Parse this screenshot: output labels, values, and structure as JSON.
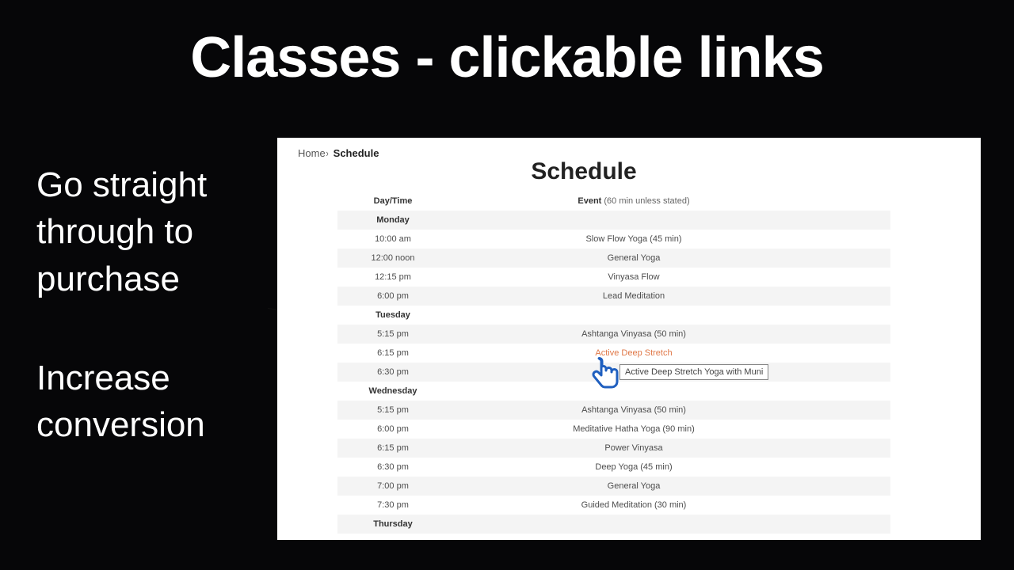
{
  "slide": {
    "title": "Classes - clickable links",
    "callout1_line1": "Go straight",
    "callout1_line2": "through to",
    "callout1_line3": "purchase",
    "callout2_line1": "Increase",
    "callout2_line2": "conversion"
  },
  "breadcrumb": {
    "home": "Home",
    "current": "Schedule"
  },
  "page": {
    "heading": "Schedule"
  },
  "table": {
    "header_time": "Day/Time",
    "header_event": "Event",
    "header_event_paren": "(60 min unless stated)",
    "days": [
      {
        "label": "Monday",
        "rows": [
          {
            "time": "10:00 am",
            "event": "Slow Flow Yoga (45 min)"
          },
          {
            "time": "12:00 noon",
            "event": "General Yoga"
          },
          {
            "time": "12:15 pm",
            "event": "Vinyasa Flow"
          },
          {
            "time": "6:00 pm",
            "event": "Lead Meditation"
          }
        ]
      },
      {
        "label": "Tuesday",
        "rows": [
          {
            "time": "5:15 pm",
            "event": "Ashtanga Vinyasa (50 min)"
          },
          {
            "time": "6:15 pm",
            "event": "Active Deep Stretch",
            "is_link": true
          },
          {
            "time": "6:30 pm",
            "event": ""
          }
        ]
      },
      {
        "label": "Wednesday",
        "rows": [
          {
            "time": "5:15 pm",
            "event": "Ashtanga Vinyasa (50 min)"
          },
          {
            "time": "6:00 pm",
            "event": "Meditative Hatha Yoga (90 min)"
          },
          {
            "time": "6:15 pm",
            "event": "Power Vinyasa"
          },
          {
            "time": "6:30 pm",
            "event": "Deep Yoga (45 min)"
          },
          {
            "time": "7:00 pm",
            "event": "General Yoga"
          },
          {
            "time": "7:30 pm",
            "event": "Guided Meditation (30 min)"
          }
        ]
      },
      {
        "label": "Thursday",
        "rows": []
      }
    ]
  },
  "tooltip": {
    "text": "Active Deep Stretch Yoga with Muni"
  }
}
